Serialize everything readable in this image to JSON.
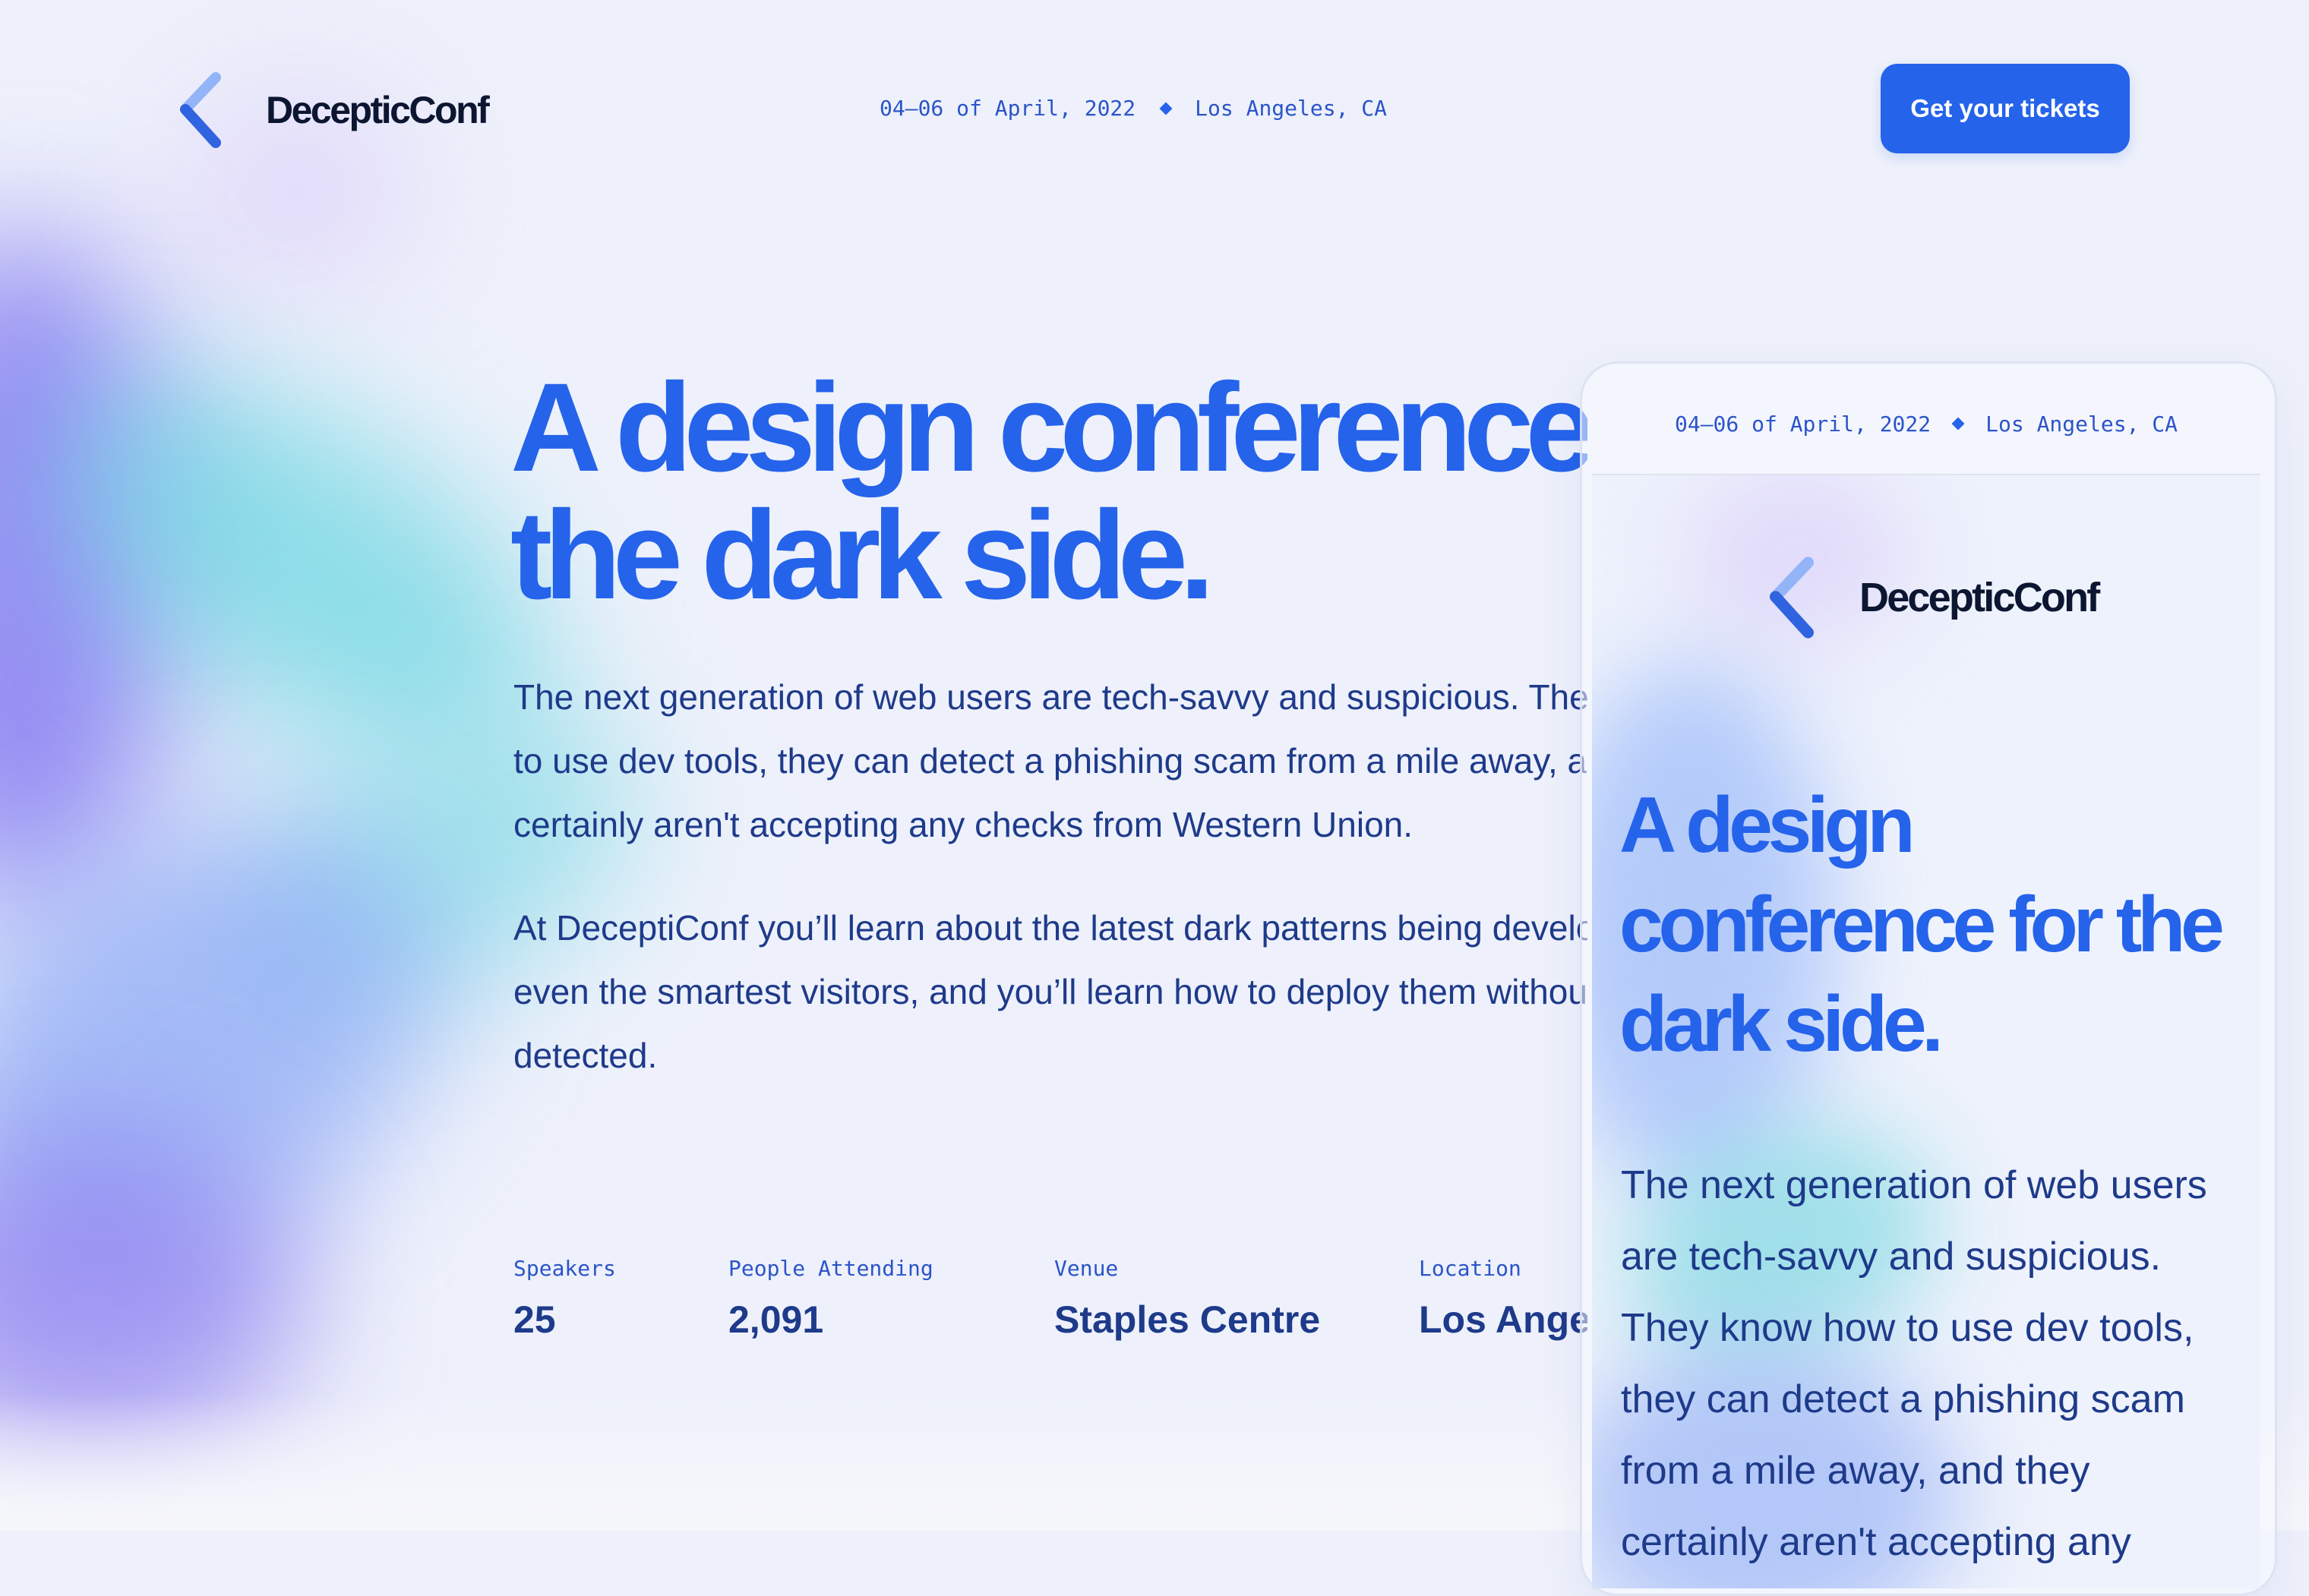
{
  "brand": {
    "name": "DecepticConf",
    "accent_color": "#2563eb",
    "text_color": "#1e3a8a",
    "dark_text_color": "#0c1631"
  },
  "header": {
    "event_dates": "04–06 of April, 2022",
    "event_location": "Los Angeles, CA",
    "cta_label": "Get your tickets"
  },
  "hero": {
    "title": "A design conference for the dark side.",
    "paragraphs": [
      "The next generation of web users are tech-savvy and suspicious. They know how to use dev tools, they can detect a phishing scam from a mile away, and they certainly aren't accepting any checks from Western Union.",
      "At DeceptiConf you’ll learn about the latest dark patterns being developed to trick even the smartest visitors, and you’ll learn how to deploy them without ever being detected."
    ]
  },
  "stats": [
    {
      "label": "Speakers",
      "value": "25"
    },
    {
      "label": "People Attending",
      "value": "2,091"
    },
    {
      "label": "Venue",
      "value": "Staples Centre"
    },
    {
      "label": "Location",
      "value": "Los Angeles"
    }
  ],
  "mobile_preview": {
    "event_dates": "04–06 of April, 2022",
    "event_location": "Los Angeles, CA",
    "brand_name": "DecepticConf",
    "title": "A design conference for the dark side.",
    "body": "The next generation of web users are tech-savvy and suspicious. They know how to use dev tools, they can detect a phishing scam from a mile away, and they certainly aren't accepting any"
  },
  "icons": {
    "logo": "chevron-left-logo-icon",
    "separator": "diamond-icon"
  }
}
